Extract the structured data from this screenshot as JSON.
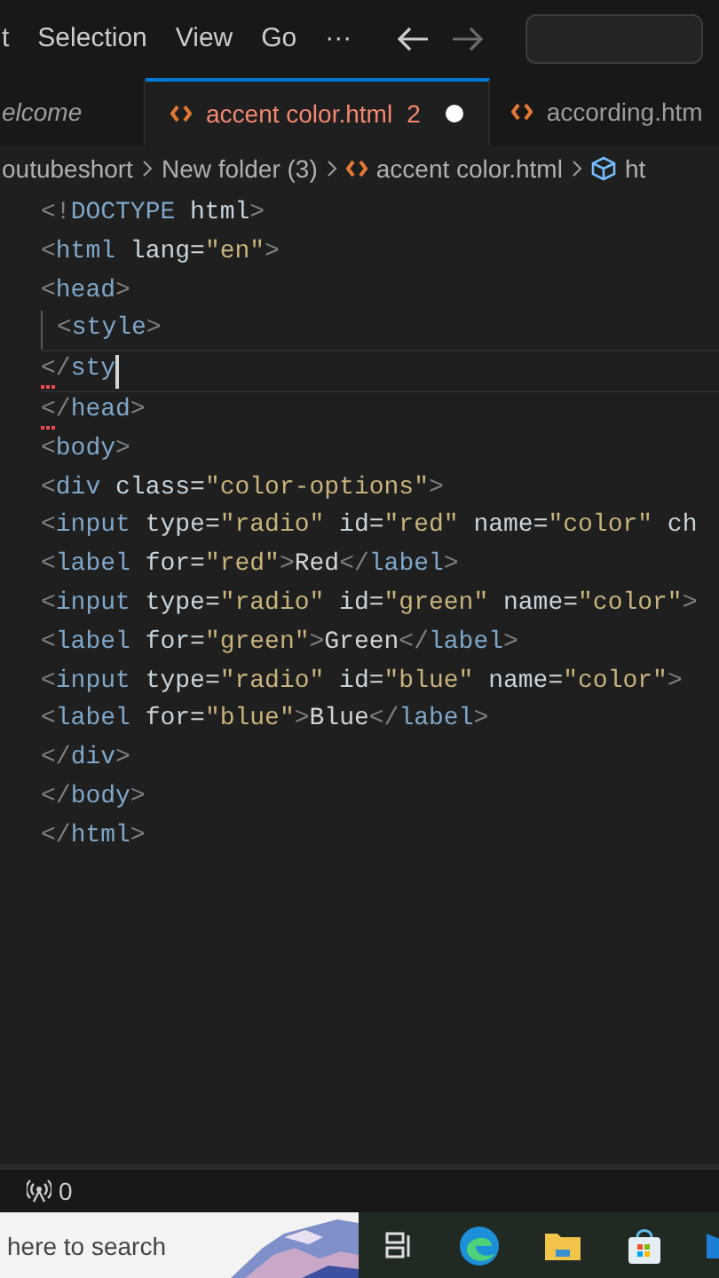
{
  "menu_bar": {
    "items": [
      "t",
      "Selection",
      "View",
      "Go",
      "···"
    ],
    "nav": [
      {
        "kind": "back",
        "disabled": false
      },
      {
        "kind": "forward",
        "disabled": true
      }
    ]
  },
  "tabs": [
    {
      "label": "elcome",
      "kind": "welcome",
      "selected": false
    },
    {
      "label": "accent color.html",
      "kind": "file",
      "problems": "2",
      "modified": true,
      "selected": true
    },
    {
      "label": "according.htm",
      "kind": "file",
      "selected": false
    }
  ],
  "breadcrumb": [
    {
      "label": "outubeshort"
    },
    {
      "label": "New folder (3)"
    },
    {
      "label": "accent color.html"
    },
    {
      "label": "ht"
    }
  ],
  "editor": {
    "lines": [
      {
        "text": "<!DOCTYPE html>"
      },
      {
        "text": "<html lang=\"en\">"
      },
      {
        "text": "<head>"
      },
      {
        "text": "<style>",
        "indent": true
      },
      {
        "text": "</sty",
        "cursor": true,
        "error": true
      },
      {
        "text": "</head>",
        "error": true
      },
      {
        "text": "<body>"
      },
      {
        "text": "<div class=\"color-options\">"
      },
      {
        "text": "<input type=\"radio\" id=\"red\" name=\"color\" ch"
      },
      {
        "text": "<label for=\"red\">Red</label>"
      },
      {
        "text": "<input type=\"radio\" id=\"green\" name=\"color\">"
      },
      {
        "text": "<label for=\"green\">Green</label>"
      },
      {
        "text": "<input type=\"radio\" id=\"blue\" name=\"color\">"
      },
      {
        "text": "<label for=\"blue\">Blue</label>"
      },
      {
        "text": "</div>"
      },
      {
        "text": "</body>"
      },
      {
        "text": "</html>"
      }
    ]
  },
  "status_bar": {
    "ports": "0"
  },
  "taskbar": {
    "search": {
      "placeholder": "here to search"
    },
    "apps": [
      {
        "kind": "task-view"
      },
      {
        "kind": "browser"
      },
      {
        "kind": "folder"
      },
      {
        "kind": "store"
      },
      {
        "kind": "mail"
      }
    ]
  }
}
